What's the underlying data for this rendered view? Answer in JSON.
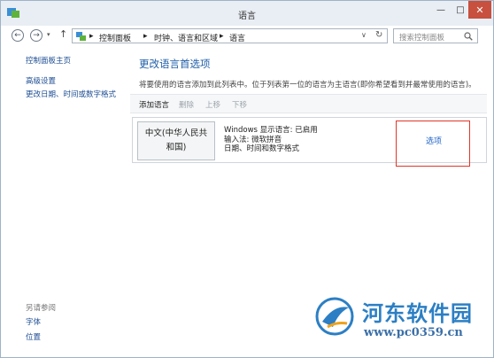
{
  "window": {
    "title": "语言",
    "min_label": "—",
    "max_label": "□",
    "close_label": "✕"
  },
  "nav": {
    "back_glyph": "←",
    "forward_glyph": "→",
    "dropdown_glyph": "▾",
    "up_glyph": "↑",
    "breadcrumbs": [
      "控制面板",
      "时钟、语言和区域",
      "语言"
    ],
    "separator": "▸",
    "address_dropdown_glyph": "∨",
    "refresh_glyph": "↻"
  },
  "search": {
    "placeholder": "搜索控制面板"
  },
  "sidebar": {
    "home": "控制面板主页",
    "links": [
      "高级设置",
      "更改日期、时间或数字格式"
    ],
    "see_also_title": "另请参阅",
    "see_also_links": [
      "字体",
      "位置"
    ]
  },
  "main": {
    "heading": "更改语言首选项",
    "description": "将要使用的语言添加到此列表中。位于列表第一位的语言为主语言(即你希望看到并最常使用的语言)。",
    "toolbar": {
      "add": "添加语言",
      "remove": "删除",
      "move_up": "上移",
      "move_down": "下移"
    },
    "languages": [
      {
        "name": "中文(中华人民共和国)",
        "details": [
          "Windows 显示语言: 已启用",
          "输入法: 微软拼音",
          "日期、时间和数字格式"
        ],
        "options": "选项"
      }
    ]
  },
  "watermark": {
    "name": "河东软件园",
    "url": "www.pc0359.cn"
  },
  "colors": {
    "link": "#1d4d93",
    "heading": "#1f5ea8",
    "highlight_frame": "#e0362a",
    "close_button": "#c7503e"
  }
}
